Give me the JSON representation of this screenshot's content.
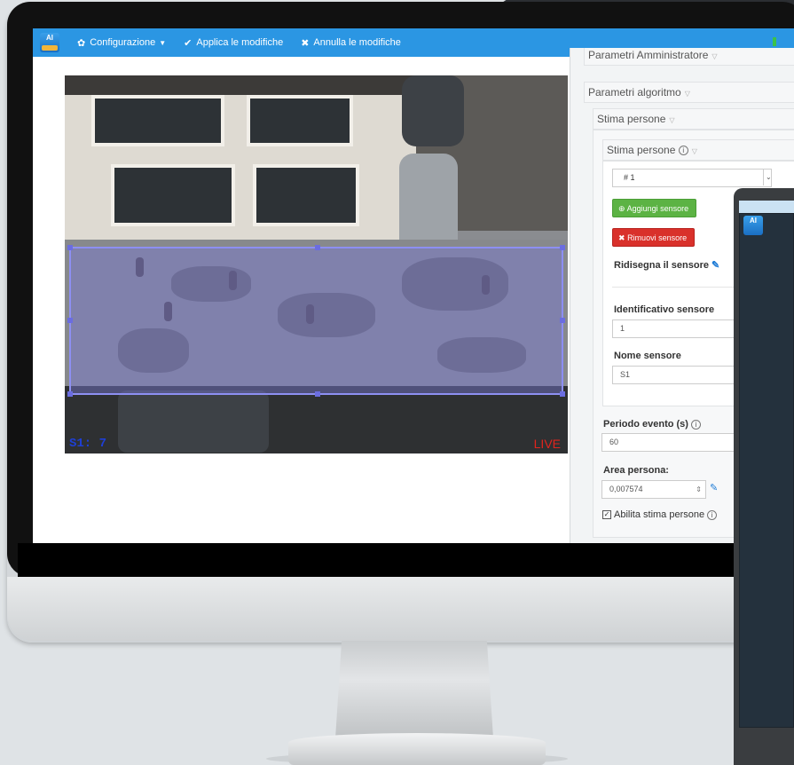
{
  "navbar": {
    "logo_text": "AI",
    "config_label": "Configurazione",
    "apply_label": "Applica le modifiche",
    "cancel_label": "Annulla le modifiche"
  },
  "video": {
    "camera_label": "S1: 7",
    "live_label": "LIVE"
  },
  "panel": {
    "admin_params": "Parametri Amministratore",
    "algo_params": "Parametri algoritmo",
    "stima_persone_outer": "Stima persone",
    "stima_persone_inner": "Stima persone",
    "sensor_selected": "# 1",
    "add_sensor": "Aggiungi sensore",
    "remove_sensor": "Rimuovi sensore",
    "redraw_sensor": "Ridisegna il sensore",
    "sensor_id_label": "Identificativo sensore",
    "sensor_id_value": "1",
    "sensor_name_label": "Nome sensore",
    "sensor_name_value": "S1",
    "event_period_label": "Periodo evento (s)",
    "event_period_value": "60",
    "person_area_label": "Area persona:",
    "person_area_value": "0,007574",
    "enable_label": "Abilita stima persone"
  },
  "device2": {
    "logo_text": "AI"
  }
}
